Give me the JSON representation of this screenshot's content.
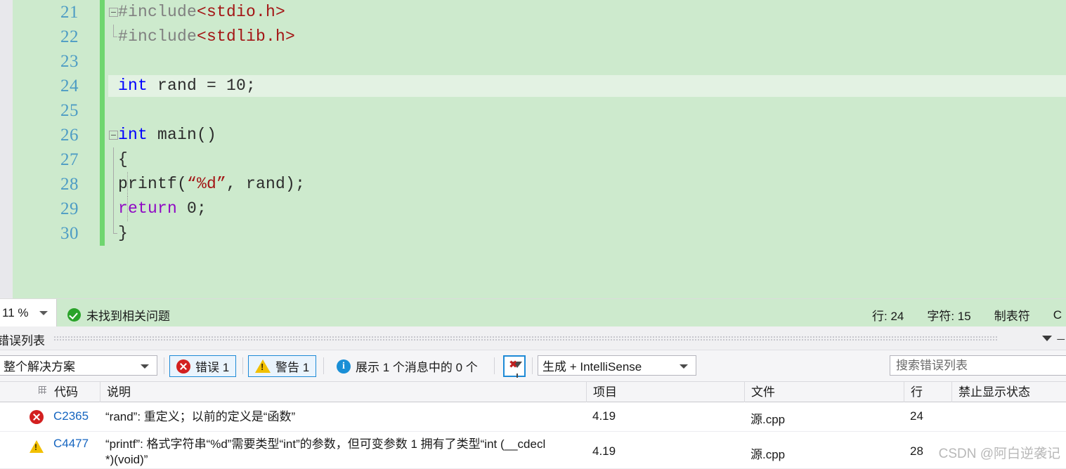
{
  "editor": {
    "lines": [
      {
        "num": "21",
        "indent": 0,
        "glyph": "collapse-minus",
        "fold": "none",
        "tokens": [
          {
            "t": "#include",
            "c": "gray"
          },
          {
            "t": "<stdio.h>",
            "c": "red"
          }
        ]
      },
      {
        "num": "22",
        "indent": 0,
        "glyph": "none",
        "fold": "elbow",
        "tokens": [
          {
            "t": "#include",
            "c": "gray"
          },
          {
            "t": "<stdlib.h>",
            "c": "red"
          }
        ]
      },
      {
        "num": "23",
        "indent": 0,
        "glyph": "none",
        "fold": "none",
        "tokens": []
      },
      {
        "num": "24",
        "indent": 0,
        "glyph": "none",
        "fold": "none",
        "current": true,
        "tokens": [
          {
            "t": "int",
            "c": "blue"
          },
          {
            "t": " rand = 10;",
            "c": "dark"
          }
        ]
      },
      {
        "num": "25",
        "indent": 0,
        "glyph": "none",
        "fold": "none",
        "tokens": []
      },
      {
        "num": "26",
        "indent": 0,
        "glyph": "collapse-minus",
        "fold": "none",
        "tokens": [
          {
            "t": "int",
            "c": "blue"
          },
          {
            "t": " main()",
            "c": "dark"
          }
        ]
      },
      {
        "num": "27",
        "indent": 1,
        "glyph": "none",
        "fold": "line",
        "tokens": [
          {
            "t": "{",
            "c": "dark"
          }
        ]
      },
      {
        "num": "28",
        "indent": 2,
        "glyph": "none",
        "fold": "line-dotted",
        "tokens": [
          {
            "t": "    printf(",
            "c": "dark"
          },
          {
            "t": "“%d”",
            "c": "red"
          },
          {
            "t": ", rand);",
            "c": "dark"
          }
        ]
      },
      {
        "num": "29",
        "indent": 2,
        "glyph": "none",
        "fold": "line-dotted",
        "tokens": [
          {
            "t": "    ",
            "c": "dark"
          },
          {
            "t": "return",
            "c": "purple"
          },
          {
            "t": " 0;",
            "c": "dark"
          }
        ]
      },
      {
        "num": "30",
        "indent": 1,
        "glyph": "none",
        "fold": "line-end",
        "tokens": [
          {
            "t": "}",
            "c": "dark"
          }
        ]
      }
    ]
  },
  "statusbar": {
    "zoom_value": "11 %",
    "issue_icon": "check-circle-icon",
    "issue_text": "未找到相关问题",
    "line_label": "行: 24",
    "char_label": "字符: 15",
    "tabs_label": "制表符",
    "encoding_label": "C"
  },
  "error_panel": {
    "title": "错误列表",
    "toolbar": {
      "scope_value": "整个解决方案",
      "errors_label": "错误 1",
      "warnings_label": "警告 1",
      "messages_label": "展示 1 个消息中的 0 个",
      "clear_filter_icon": "clear-filter-icon",
      "build_value": "生成 + IntelliSense",
      "search_placeholder": "搜索错误列表",
      "search_value": ""
    },
    "columns": [
      {
        "key": "code",
        "label": "代码"
      },
      {
        "key": "description",
        "label": "说明"
      },
      {
        "key": "project",
        "label": "项目"
      },
      {
        "key": "file",
        "label": "文件"
      },
      {
        "key": "line",
        "label": "行"
      },
      {
        "key": "suppression",
        "label": "禁止显示状态"
      }
    ],
    "rows": [
      {
        "severity": "error",
        "code": "C2365",
        "description": "“rand”: 重定义；以前的定义是“函数”",
        "project": "4.19",
        "file": "源.cpp",
        "line": "24",
        "suppression": ""
      },
      {
        "severity": "warning",
        "code": "C4477",
        "description": "“printf”: 格式字符串“%d”需要类型“int”的参数，但可变参数 1 拥有了类型“int (__cdecl\n*)(void)”",
        "project": "4.19",
        "file": "源.cpp",
        "line": "28",
        "suppression": ""
      }
    ]
  },
  "watermark": {
    "text": "CSDN @阿白逆袭记"
  },
  "colors": {
    "editor_bg": "#cdeacd",
    "current_line_bg": "#e3f2e3",
    "change_bar": "#6fd66f",
    "line_number": "#4d9cc4",
    "keyword": "#0000ff",
    "string": "#a31515",
    "return_keyword": "#8f08c4",
    "link": "#1565c0",
    "error_red": "#d32020",
    "warning_yellow": "#f2c000",
    "info_blue": "#1a8fd6",
    "accent_border": "#1e8ad6"
  }
}
